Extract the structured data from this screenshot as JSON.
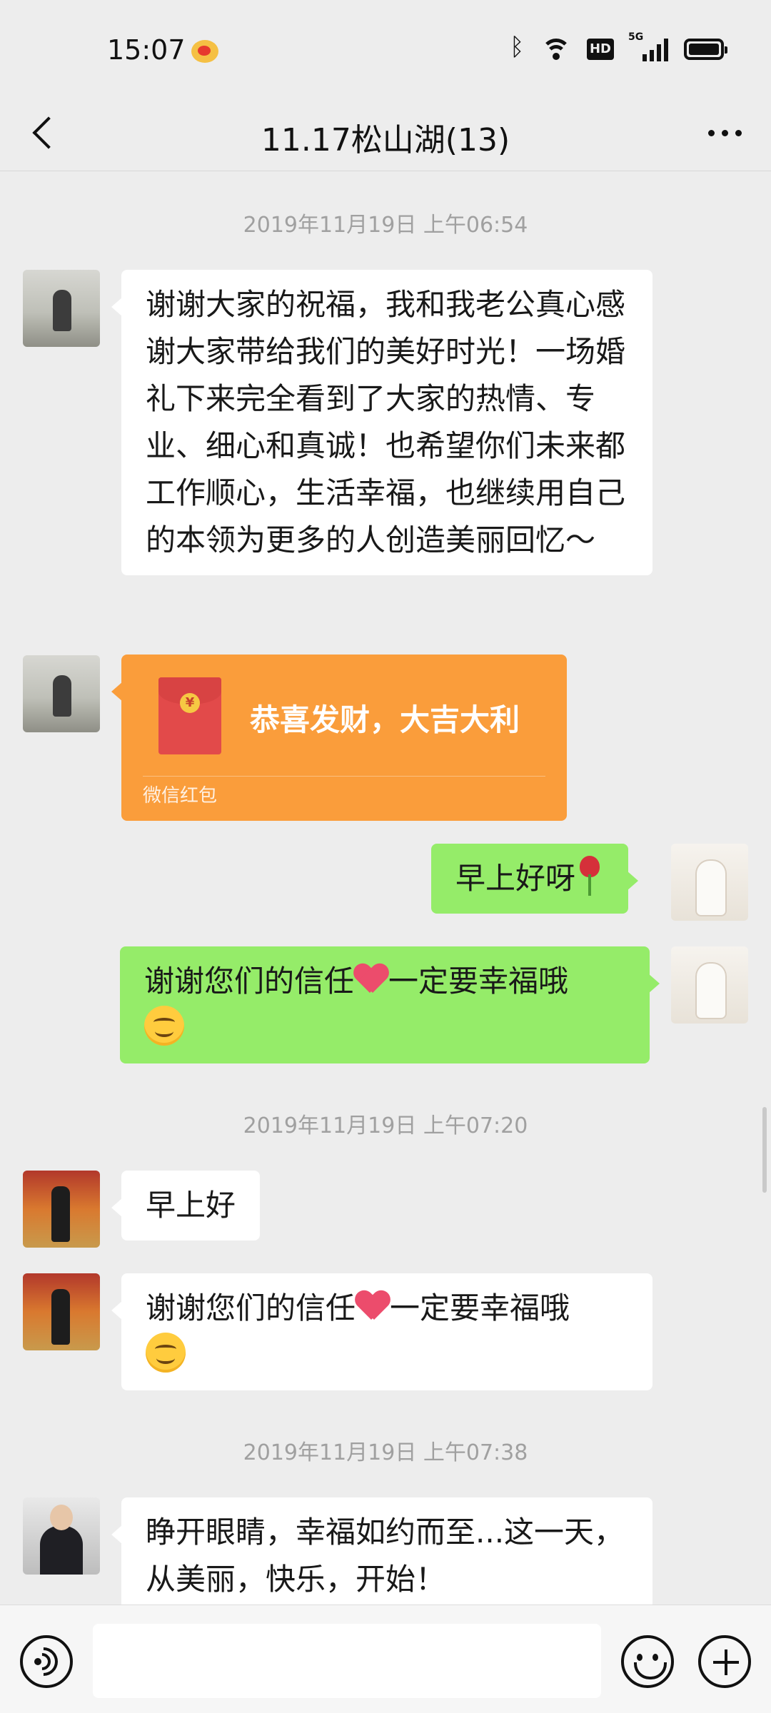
{
  "status": {
    "time": "15:07",
    "hd_badge": "HD",
    "network_label": "5G"
  },
  "nav": {
    "title": "11.17松山湖(13)"
  },
  "timestamps": [
    "2019年11月19日 上午06:54",
    "2019年11月19日 上午07:20",
    "2019年11月19日 上午07:38"
  ],
  "messages": [
    {
      "side": "in",
      "text": "谢谢大家的祝福，我和我老公真心感谢大家带给我们的美好时光！一场婚礼下来完全看到了大家的热情、专业、细心和真诚！也希望你们未来都工作顺心，生活幸福，也继续用自己的本领为更多的人创造美丽回忆～"
    },
    {
      "side": "out",
      "text": "早上好呀"
    },
    {
      "side": "out",
      "text_before": "谢谢您们的信任",
      "text_after": "一定要幸福哦"
    },
    {
      "side": "in",
      "text": "早上好"
    },
    {
      "side": "in",
      "text_before": "谢谢您们的信任",
      "text_after": "一定要幸福哦"
    },
    {
      "side": "in",
      "text": "睁开眼睛，幸福如约而至...这一天，从美丽，快乐，开始！"
    }
  ],
  "red_packet": {
    "greeting": "恭喜发财，大吉大利",
    "footer": "微信红包",
    "coin_symbol": "¥"
  },
  "input": {
    "value": "",
    "placeholder": ""
  },
  "icons": {
    "back": "chevron-left-icon",
    "more": "more-dots-icon",
    "voice": "voice-icon",
    "emoji": "emoji-icon",
    "add": "add-icon"
  },
  "colors": {
    "background": "#ededed",
    "bubble_in": "#ffffff",
    "bubble_out": "#95ec69",
    "red_packet": "#fa9d3b"
  }
}
